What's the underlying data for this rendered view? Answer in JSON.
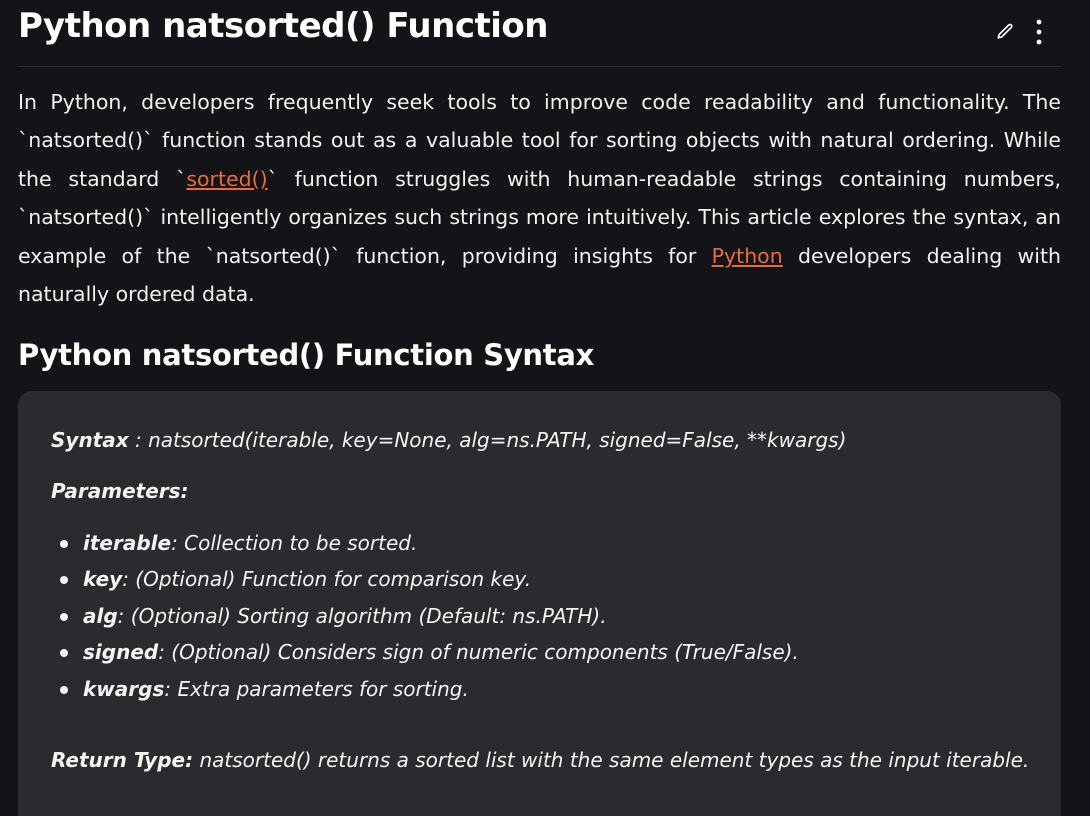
{
  "article": {
    "title": "Python natsorted() Function",
    "intro": {
      "part1": "In Python, developers frequently seek tools to improve code readability and functionality. The `natsorted()` function stands out as a valuable tool for sorting objects with natural ordering. While the standard `",
      "link_sorted": "sorted()",
      "part2": "` function struggles with human-readable strings containing numbers, `natsorted()` intelligently organizes such strings more intuitively. This article explores the syntax, an example of the `natsorted()` function, providing insights for ",
      "link_python": "Python",
      "part3": " developers dealing with naturally ordered data."
    },
    "syntax_heading": "Python natsorted() Function Syntax"
  },
  "icons": {
    "edit": "pencil-icon",
    "more": "more-vertical-icon"
  },
  "colors": {
    "background": "#131417",
    "box": "#2a2b2f",
    "link": "#f06a36"
  },
  "syntax_box": {
    "syntax_label": "Syntax",
    "syntax_value": " : natsorted(iterable, key=None, alg=ns.PATH, signed=False, **kwargs)",
    "params_label": "Parameters:",
    "params": [
      {
        "name": "iterable",
        "desc": ": Collection to be sorted."
      },
      {
        "name": "key",
        "desc": ": (Optional) Function for comparison key."
      },
      {
        "name": "alg",
        "desc": ": (Optional) Sorting algorithm (Default: ns.PATH)."
      },
      {
        "name": "signed",
        "desc": ": (Optional) Considers sign of numeric components (True/False)."
      },
      {
        "name": "kwargs",
        "desc": ": Extra parameters for sorting."
      }
    ],
    "return_label": "Return Type:",
    "return_value": " natsorted() returns a sorted list with the same element types as the input iterable."
  }
}
